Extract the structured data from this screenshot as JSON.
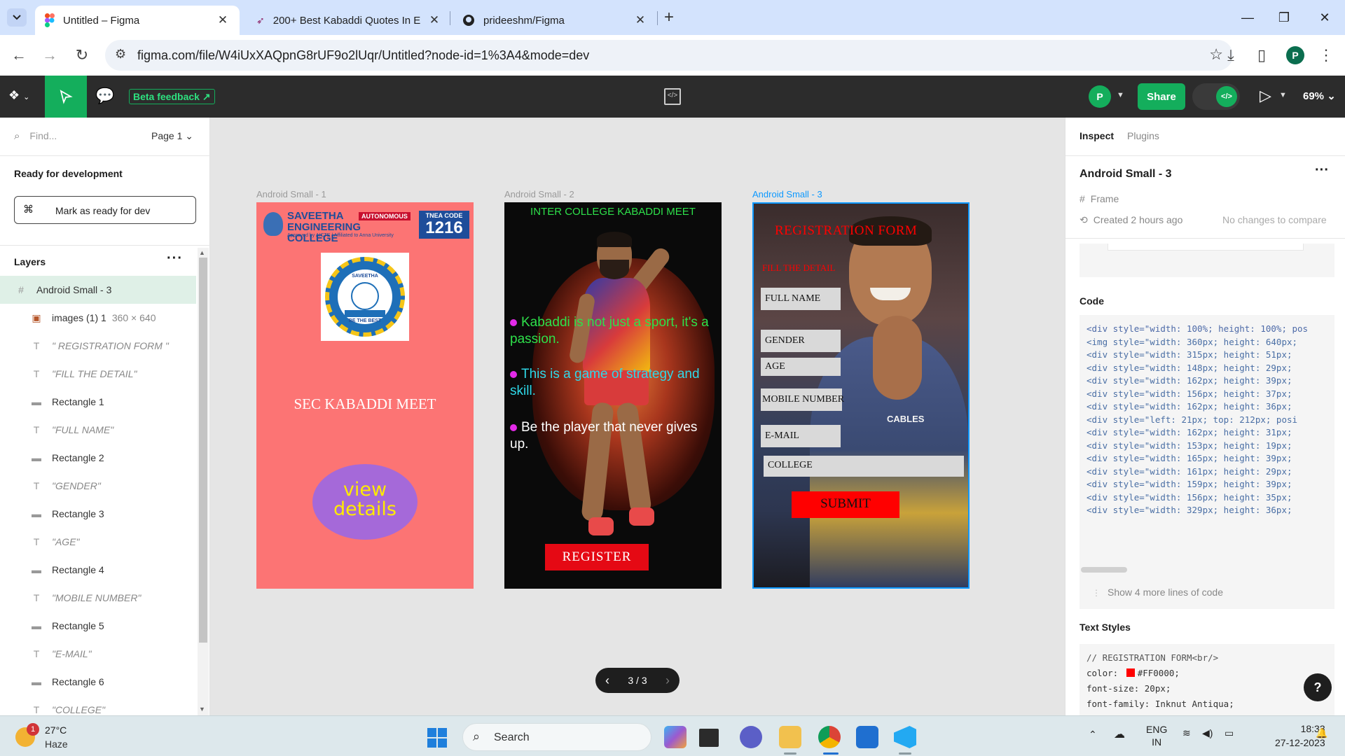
{
  "browser": {
    "tabs": [
      {
        "title": "Untitled – Figma",
        "active": true
      },
      {
        "title": "200+ Best Kabaddi Quotes In E",
        "active": false
      },
      {
        "title": "prideeshm/Figma",
        "active": false
      }
    ],
    "url": "figma.com/file/W4iUxXAQpnG8rUF9o2lUqr/Untitled?node-id=1%3A4&mode=dev",
    "profile_initial": "P"
  },
  "figma_toolbar": {
    "beta_feedback": "Beta feedback",
    "user_initial": "P",
    "share_label": "Share",
    "dev_mode_label": "</>",
    "zoom": "69%"
  },
  "left_panel": {
    "find_placeholder": "Find...",
    "page": "Page 1",
    "ready_title": "Ready for development",
    "mark_ready_label": "Mark as ready for dev",
    "layers_title": "Layers",
    "layers": [
      {
        "name": "Android Small - 3",
        "kind": "frame",
        "dims": ""
      },
      {
        "name": "images (1) 1",
        "kind": "image",
        "dims": "360 × 640"
      },
      {
        "name": "\" REGISTRATION FORM \"",
        "kind": "text",
        "dims": ""
      },
      {
        "name": "\"FILL THE DETAIL\"",
        "kind": "text",
        "dims": ""
      },
      {
        "name": "Rectangle 1",
        "kind": "rect",
        "dims": ""
      },
      {
        "name": "\"FULL NAME\"",
        "kind": "text",
        "dims": ""
      },
      {
        "name": "Rectangle 2",
        "kind": "rect",
        "dims": ""
      },
      {
        "name": "\"GENDER\"",
        "kind": "text",
        "dims": ""
      },
      {
        "name": "Rectangle 3",
        "kind": "rect",
        "dims": ""
      },
      {
        "name": "\"AGE\"",
        "kind": "text",
        "dims": ""
      },
      {
        "name": "Rectangle 4",
        "kind": "rect",
        "dims": ""
      },
      {
        "name": "\"MOBILE NUMBER\"",
        "kind": "text",
        "dims": ""
      },
      {
        "name": "Rectangle 5",
        "kind": "rect",
        "dims": ""
      },
      {
        "name": "\"E-MAIL\"",
        "kind": "text",
        "dims": ""
      },
      {
        "name": "Rectangle 6",
        "kind": "rect",
        "dims": ""
      },
      {
        "name": "\"COLLEGE\"",
        "kind": "text",
        "dims": ""
      }
    ]
  },
  "canvas": {
    "frames": [
      {
        "label": "Android Small - 1"
      },
      {
        "label": "Android Small - 2"
      },
      {
        "label": "Android Small - 3"
      }
    ],
    "frame1": {
      "college_name": "SAVEETHA ENGINEERING COLLEGE",
      "autonomous": "AUTONOMOUS",
      "tnea_label": "TNEA CODE",
      "tnea_code": "1216",
      "approval": "Approved by AICTE | Affiliated to Anna University",
      "emblem_top": "SAVEETHA",
      "emblem_bottom": "BE THE BEST",
      "meet_title": "SEC KABADDI MEET",
      "view_details": "view details"
    },
    "frame2": {
      "title": "INTER COLLEGE KABADDI MEET",
      "bullets": [
        "Kabaddi is not just a sport, it's a passion.",
        "This is a game of strategy and skill.",
        "Be the player that never gives up."
      ],
      "register": "REGISTER"
    },
    "frame3": {
      "title": "REGISTRATION FORM",
      "subtitle": "FILL THE DETAIL",
      "fields": [
        "FULL NAME",
        "GENDER",
        "AGE",
        "MOBILE NUMBER",
        "E-MAIL",
        "COLLEGE"
      ],
      "submit": "SUBMIT",
      "jersey_text": "CABLES"
    },
    "pager": "3 / 3"
  },
  "right_panel": {
    "tabs": [
      "Inspect",
      "Plugins"
    ],
    "selection_name": "Android Small - 3",
    "type": "Frame",
    "created": "Created 2 hours ago",
    "compare": "No changes to compare",
    "code_title": "Code",
    "code_lines": [
      "<div style=\"width: 100%; height: 100%; pos",
      "  <img style=\"width: 360px; height: 640px;",
      "  <div style=\"width: 315px; height: 51px;",
      "  <div style=\"width: 148px; height: 29px;",
      "  <div style=\"width: 162px; height: 39px;",
      "  <div style=\"width: 156px; height: 37px;",
      "  <div style=\"width: 162px; height: 36px;",
      "  <div style=\"left: 21px; top: 212px; posi",
      "  <div style=\"width: 162px; height: 31px;",
      "  <div style=\"width: 153px; height: 19px;",
      "  <div style=\"width: 165px; height: 39px;",
      "  <div style=\"width: 161px; height: 29px;",
      "  <div style=\"width: 159px; height: 39px;",
      "  <div style=\"width: 156px; height: 35px;",
      "  <div style=\"width: 329px; height: 36px;"
    ],
    "show_more": "Show 4 more lines of code",
    "text_styles_title": "Text Styles",
    "style_lines": [
      "// REGISTRATION FORM<br/>",
      "color: ",
      "font-size: 20px;",
      "font-family: Inknut Antiqua;"
    ],
    "style_color_value": "#FF0000;",
    "help": "?"
  },
  "taskbar": {
    "temperature": "27°C",
    "condition": "Haze",
    "weather_badge": "1",
    "search": "Search",
    "lang_top": "ENG",
    "lang_bottom": "IN",
    "time": "18:33",
    "date": "27-12-2023"
  }
}
